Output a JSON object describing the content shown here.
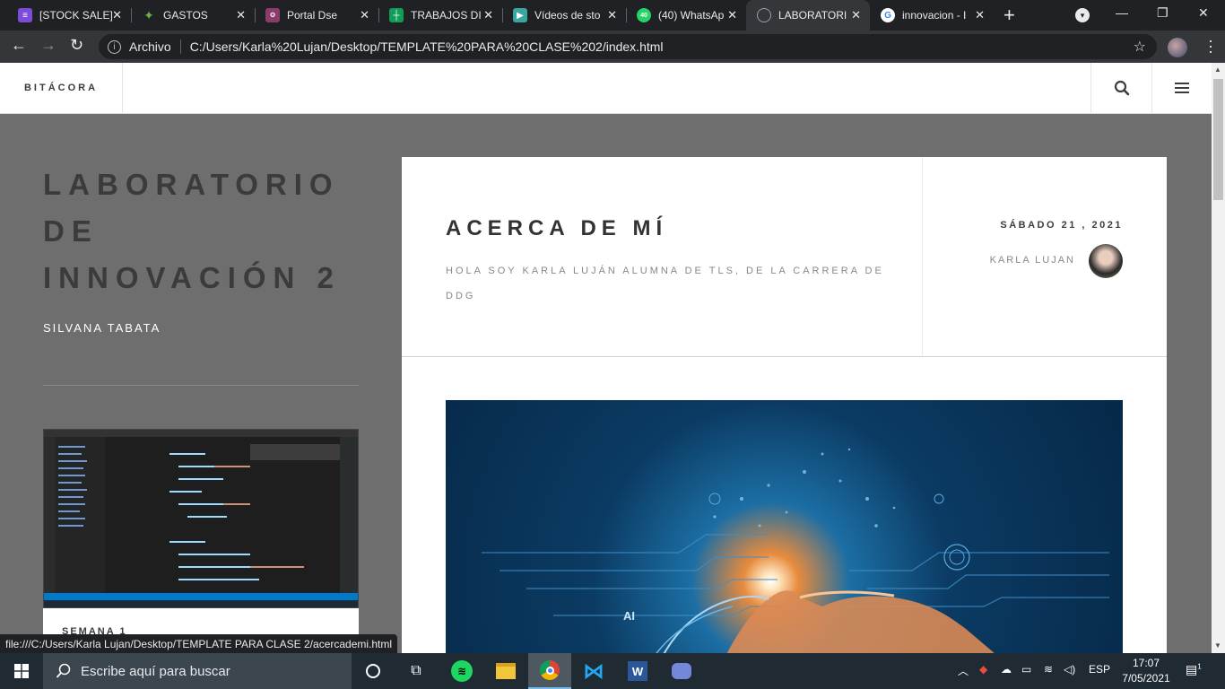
{
  "browser": {
    "tabs": [
      {
        "title": "[STOCK SALE]",
        "favicon": "list-icon",
        "color": "#7b4cd9"
      },
      {
        "title": "GASTOS",
        "favicon": "money-icon",
        "color": "#6ab04c"
      },
      {
        "title": "Portal Dse",
        "favicon": "portal-icon",
        "color": "#8c3b6b"
      },
      {
        "title": "TRABAJOS DI",
        "favicon": "sheets-icon",
        "color": "#0f9d58"
      },
      {
        "title": "Vídeos de sto",
        "favicon": "video-icon",
        "color": "#3aa6a0"
      },
      {
        "title": "(40) WhatsAp",
        "favicon": "whatsapp-icon",
        "color": "#25d366"
      },
      {
        "title": "LABORATORI",
        "favicon": "globe-icon",
        "color": "#9aa0a6"
      },
      {
        "title": "innovacion - I",
        "favicon": "google-icon",
        "color": "#4285f4"
      }
    ],
    "whatsapp_badge": "40",
    "address_prefix": "Archivo",
    "url": "C:/Users/Karla%20Lujan/Desktop/TEMPLATE%20PARA%20CLASE%202/index.html",
    "status_url": "file:///C:/Users/Karla Lujan/Desktop/TEMPLATE PARA CLASE 2/acercademi.html"
  },
  "site": {
    "brand": "BITÁCORA",
    "sidebar": {
      "title": "LABORATORIO DE INNOVACIÓN 2",
      "subtitle": "SILVANA TABATA",
      "card_label": "SEMANA 1"
    },
    "post": {
      "title": "ACERCA DE MÍ",
      "description": "HOLA SOY KARLA LUJÁN ALUMNA DE TLS, DE LA CARRERA DE DDG",
      "date": "SÁBADO 21 , 2021",
      "author": "KARLA LUJAN",
      "hero_text": "AI"
    }
  },
  "taskbar": {
    "search_placeholder": "Escribe aquí para buscar",
    "language": "ESP",
    "time": "17:07",
    "date": "7/05/2021",
    "notifications": "1"
  },
  "colors": {
    "page_bg": "#6e6e6e",
    "tabbar": "#202124",
    "toolbar": "#35363a",
    "taskbar": "#1f2a33"
  }
}
